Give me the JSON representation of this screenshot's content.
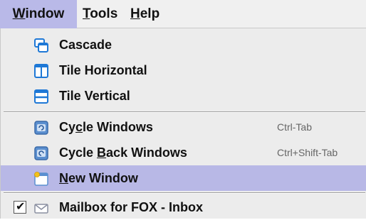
{
  "menubar": {
    "window": {
      "mnemonic": "W",
      "rest": "indow"
    },
    "tools": {
      "mnemonic": "T",
      "rest": "ools"
    },
    "help": {
      "mnemonic": "H",
      "rest": "elp"
    }
  },
  "menu": {
    "cascade": "Cascade",
    "tile_horizontal": "Tile Horizontal",
    "tile_vertical": "Tile Vertical",
    "cycle_windows": {
      "pre": "Cy",
      "mnemonic": "c",
      "post": "le Windows",
      "shortcut": "Ctrl-Tab"
    },
    "cycle_back_windows": {
      "pre": "Cycle ",
      "mnemonic": "B",
      "post": "ack Windows",
      "shortcut": "Ctrl+Shift-Tab"
    },
    "new_window": {
      "mnemonic": "N",
      "rest": "ew Window"
    },
    "mailbox": {
      "label": "Mailbox for FOX - Inbox",
      "checked": true
    }
  },
  "colors": {
    "selected_bg": "#b8b8e6",
    "menu_bg": "#ececec",
    "icon_blue": "#1e78d6"
  }
}
